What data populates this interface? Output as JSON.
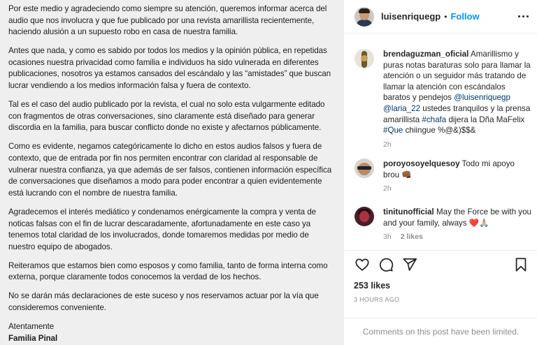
{
  "post_text": {
    "paragraphs": [
      "Por este medio y agradeciendo como siempre su atención, queremos informar acerca del audio que nos involucra y que fue publicado por una revista amarillista recientemente, haciendo alusión a un supuesto robo en casa de nuestra familia.",
      "Antes que nada, y como es sabido por todos los medios y la opinión pública, en repetidas ocasiones nuestra privacidad como familia e individuos ha sido vulnerada en diferentes publicaciones, nosotros ya estamos cansados del escándalo y las “amistades” que buscan lucrar vendiendo a los medios información falsa y fuera de contexto.",
      "Tal es el caso del audio publicado por la revista, el cual no solo esta vulgarmente editado con fragmentos de otras conversaciones, sino claramente está diseñado para generar discordia en la familia, para buscar conflicto donde no existe y afectarnos públicamente.",
      "Como es evidente, negamos categóricamente lo dicho en estos audios falsos y fuera de contexto, que de entrada por fin nos permiten encontrar con claridad al responsable de vulnerar nuestra confianza, ya que además de ser falsos, contienen información específica de conversaciones que diseñamos a modo para poder encontrar a quien evidentemente está lucrando con el nombre de nuestra familia.",
      "Agradecemos el interés mediático y condenamos enérgicamente la compra y venta de noticas falsas con el fin de lucrar descaradamente, afortunadamente en este caso ya tenemos total claridad de los involucrados, donde tomaremos medidas por medio de nuestro equipo de abogados.",
      "Reiteramos que estamos bien como esposos y como familia, tanto de forma interna como externa, porque claramente todos conocemos la verdad de los hechos.",
      "No se darán más declaraciones de este suceso y nos reservamos actuar por la vía que consideremos conveniente."
    ],
    "closing": "Atentamente",
    "signature": "Familia Pinal"
  },
  "header": {
    "username": "luisenriquegp",
    "separator": "•",
    "follow_label": "Follow",
    "avatar_icon": "profile-avatar",
    "more_icon": "ellipsis-icon"
  },
  "comments": [
    {
      "username": "brendaguzman_oficial",
      "parts": [
        {
          "t": "Amarillismo y puras notas baraturas solo para llamar la atención o un seguidor más tratando de llamar la atención con escándalos baratos y pendejos ",
          "link": false
        },
        {
          "t": "@luisenriquegp",
          "link": true
        },
        {
          "t": " ",
          "link": false
        },
        {
          "t": "@laria_22",
          "link": true
        },
        {
          "t": " ustedes tranquilos y la prensa amarillista ",
          "link": false
        },
        {
          "t": "#chafa",
          "link": true
        },
        {
          "t": " dijera la Dña MaFelix ",
          "link": false
        },
        {
          "t": "#Que",
          "link": true
        },
        {
          "t": " chiingue %@&)$$&",
          "link": false
        }
      ],
      "time": "2h",
      "likes": ""
    },
    {
      "username": "poroyosoyelquesoy",
      "parts": [
        {
          "t": "Todo mi apoyo brou 👊🏾",
          "link": false
        }
      ],
      "time": "2h",
      "likes": ""
    },
    {
      "username": "tinitunofficial",
      "parts": [
        {
          "t": "May the Force be with you and your family, always ❤️🙏🏼",
          "link": false
        }
      ],
      "time": "3h",
      "likes": "2 likes"
    }
  ],
  "actions": {
    "like_icon": "heart-icon",
    "comment_icon": "comment-bubble-icon",
    "share_icon": "paper-plane-icon",
    "save_icon": "bookmark-icon"
  },
  "likes_count": "253 likes",
  "time_ago": "3 HOURS AGO",
  "comments_limited_notice": "Comments on this post have been limited."
}
